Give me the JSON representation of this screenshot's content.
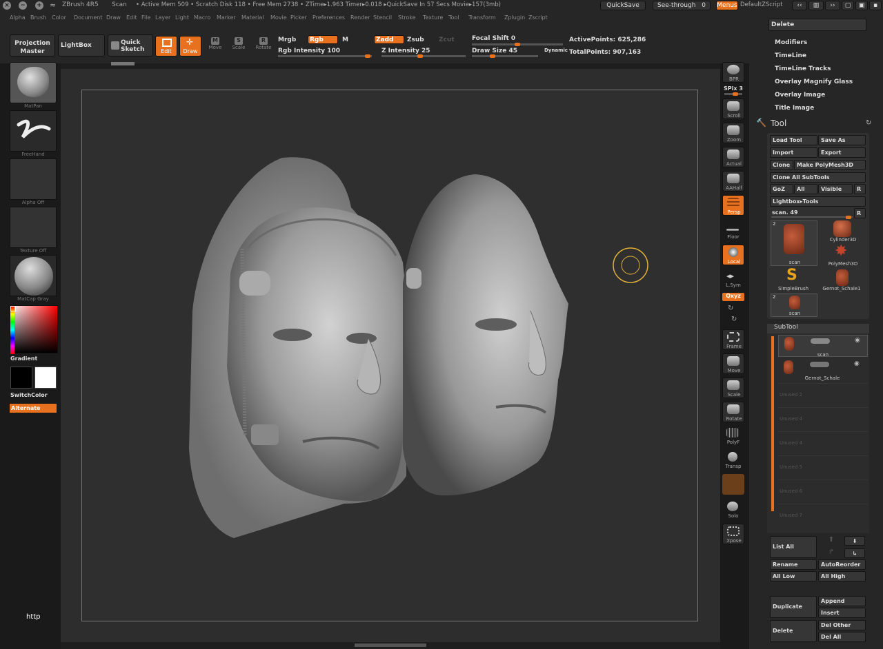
{
  "titlebar": {
    "app": "ZBrush 4R5",
    "doc": "Scan",
    "stats": "• Active Mem 509 • Scratch Disk 118 • Free Mem 2738 • ZTime▸1.963 Timer▸0.018 ▸QuickSave In 57 Secs Movie▸157(3mb)",
    "quicksave": "QuickSave",
    "see_through": "See-through",
    "see_through_value": "0",
    "menus": "Menus",
    "default_zscript": "DefaultZScript"
  },
  "menubar": [
    "Alpha",
    "Brush",
    "Color",
    "Document",
    "Draw",
    "Edit",
    "File",
    "Layer",
    "Light",
    "Macro",
    "Marker",
    "Material",
    "Movie",
    "Picker",
    "Preferences",
    "Render",
    "Stencil",
    "Stroke",
    "Texture",
    "Tool",
    "Transform",
    "Zplugin",
    "Zscript"
  ],
  "topshelf": {
    "projection_master": "Projection Master",
    "lightbox": "LightBox",
    "quick_sketch": "Quick Sketch",
    "edit": "Edit",
    "draw": "Draw",
    "move": "Move",
    "scale": "Scale",
    "rotate": "Rotate",
    "mrgb": "Mrgb",
    "rgb": "Rgb",
    "m": "M",
    "rgb_intensity": "Rgb Intensity 100",
    "zadd": "Zadd",
    "zsub": "Zsub",
    "zcut": "Zcut",
    "z_intensity": "Z Intensity 25",
    "focal_shift": "Focal Shift 0",
    "draw_size": "Draw Size 45",
    "dynamic": "Dynamic",
    "active_points": "ActivePoints: 625,286",
    "total_points": "TotalPoints: 907,163"
  },
  "leftshelf": {
    "brush": "MatPan",
    "stroke": "FreeHand",
    "alpha": "Alpha Off",
    "texture": "Texture Off",
    "material": "MatCap Gray",
    "gradient": "Gradient",
    "switchcolor": "SwitchColor",
    "alternate": "Alternate"
  },
  "rightshelf": {
    "bpr": "BPR",
    "spix": "SPix 3",
    "scroll": "Scroll",
    "zoom": "Zoom",
    "actual": "Actual",
    "aahalf": "AAHalf",
    "persp": "Persp",
    "floor": "Floor",
    "local": "Local",
    "lsym": "L.Sym",
    "xyz": "Qxyz",
    "frame": "Frame",
    "move": "Move",
    "scale": "Scale",
    "rotate": "Rotate",
    "polyf": "PolyF",
    "transp": "Transp",
    "solo": "Solo",
    "xpose": "Xpose"
  },
  "tray": {
    "delete_top": "Delete",
    "menu_items": [
      "Modifiers",
      "TimeLine",
      "TimeLine Tracks",
      "Overlay Magnify Glass",
      "Overlay Image",
      "Title Image"
    ],
    "tool_title": "Tool",
    "load_tool": "Load Tool",
    "save_as": "Save As",
    "import": "Import",
    "export": "Export",
    "clone": "Clone",
    "make_polymesh": "Make PolyMesh3D",
    "clone_all": "Clone All SubTools",
    "goz": "GoZ",
    "all": "All",
    "visible": "Visible",
    "r": "R",
    "lightbox_tools": "Lightbox▸Tools",
    "scan_slider": "scan. 49",
    "tools": [
      {
        "name": "scan",
        "count": "2"
      },
      {
        "name": "Cylinder3D",
        "count": ""
      },
      {
        "name": "PolyMesh3D",
        "count": ""
      },
      {
        "name": "SimpleBrush",
        "count": ""
      },
      {
        "name": "Gernot_Schale1",
        "count": ""
      },
      {
        "name": "scan",
        "count": "2"
      }
    ],
    "subtool_title": "SubTool",
    "subtools": [
      "scan",
      "Gernot_Schale"
    ],
    "empty_slots": [
      "Unused 2",
      "Unused 4",
      "Unused 4",
      "Unused 5",
      "Unused 6",
      "Unused 7"
    ],
    "list_all": "List All",
    "rename": "Rename",
    "autoreorder": "AutoReorder",
    "all_low": "All Low",
    "all_high": "All High",
    "duplicate": "Duplicate",
    "append": "Append",
    "insert": "Insert",
    "delete": "Delete",
    "del_other": "Del Other",
    "del_all": "Del All"
  },
  "watermark": "http",
  "colors": {
    "accent": "#e8711f",
    "bg": "#262626",
    "canvas": "#2d2d2d"
  }
}
